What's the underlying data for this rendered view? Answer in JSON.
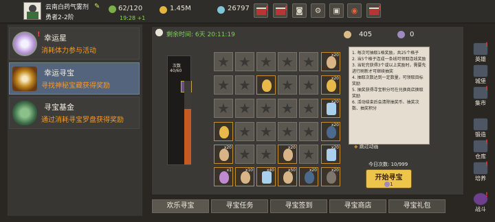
{
  "player": {
    "name": "云南白药气雾剂",
    "rank": "勇者2-2阶"
  },
  "topbar": {
    "stamina": "62/120",
    "stamina_timer": "19:28 +1",
    "gold": "1.45M",
    "gems": "26797"
  },
  "sidebar": {
    "items": [
      {
        "title": "幸运星",
        "subtitle": "消耗体力参与活动"
      },
      {
        "title": "幸运寻宝",
        "subtitle": "寻找神秘宝藏获得奖励"
      },
      {
        "title": "寻宝基金",
        "subtitle": "通过消耗寻宝罗盘获得奖励"
      }
    ]
  },
  "event": {
    "time_label": "剩余时间: 6天 20:11:19",
    "res1": "405",
    "res2": "0",
    "meter_label": "次数",
    "meter_value": "40/60",
    "meter_progress": 0.667,
    "skip_animation": "跳过动画",
    "today_count": "今日次数: 10/999",
    "start_label": "开始寻宝",
    "start_cost": "1",
    "description": [
      "1. 每次可抽取1格奖励，共25个格子",
      "2. 当5个格子连成一条线可领取连线奖励",
      "3. 当轮完获得3个或以上奖励时，需要先进行刷新才可继续抽奖",
      "4. 抽取次数达到一定数量，可领取目标奖励",
      "5. 抽奖获得寻宝积分可在兑换商店换取奖励",
      "6. 活动结束后会清除抽奖币、抽奖次数、抽奖积分"
    ]
  },
  "grid": [
    [
      "star",
      "star",
      "star",
      "star",
      "star",
      "egg_x20"
    ],
    [
      "star",
      "star",
      "egg_gold",
      "star",
      "star",
      "egg_gold_x20"
    ],
    [
      "star",
      "star",
      "star",
      "star",
      "star",
      "diamond_x20"
    ],
    [
      "egg_gold",
      "star",
      "star",
      "star",
      "star",
      "potion_x20"
    ],
    [
      "egg_x20",
      "star",
      "star",
      "egg_x20",
      "star",
      "diamond_x20"
    ],
    [
      "gem_x1",
      "egg_x10",
      "diamond_x40",
      "egg_x50",
      "potion_x20",
      "hammer_x20"
    ]
  ],
  "tabs": [
    "欢乐寻宝",
    "寻宝任务",
    "寻宝签到",
    "寻宝商店",
    "寻宝礼包"
  ],
  "right_nav": [
    "英雄",
    "城堡",
    "集市",
    "锻造",
    "仓库",
    "培养",
    "战斗"
  ],
  "top_icons": [
    "mail-icon",
    "mail-icon",
    "controller-icon",
    "gear-icon",
    "gift-icon",
    "wheel-icon",
    "bag-icon"
  ],
  "colors": {
    "accent": "#f29a2a",
    "green": "#7fd05e",
    "panel": "#3b3935",
    "button": "#ecc54a"
  }
}
